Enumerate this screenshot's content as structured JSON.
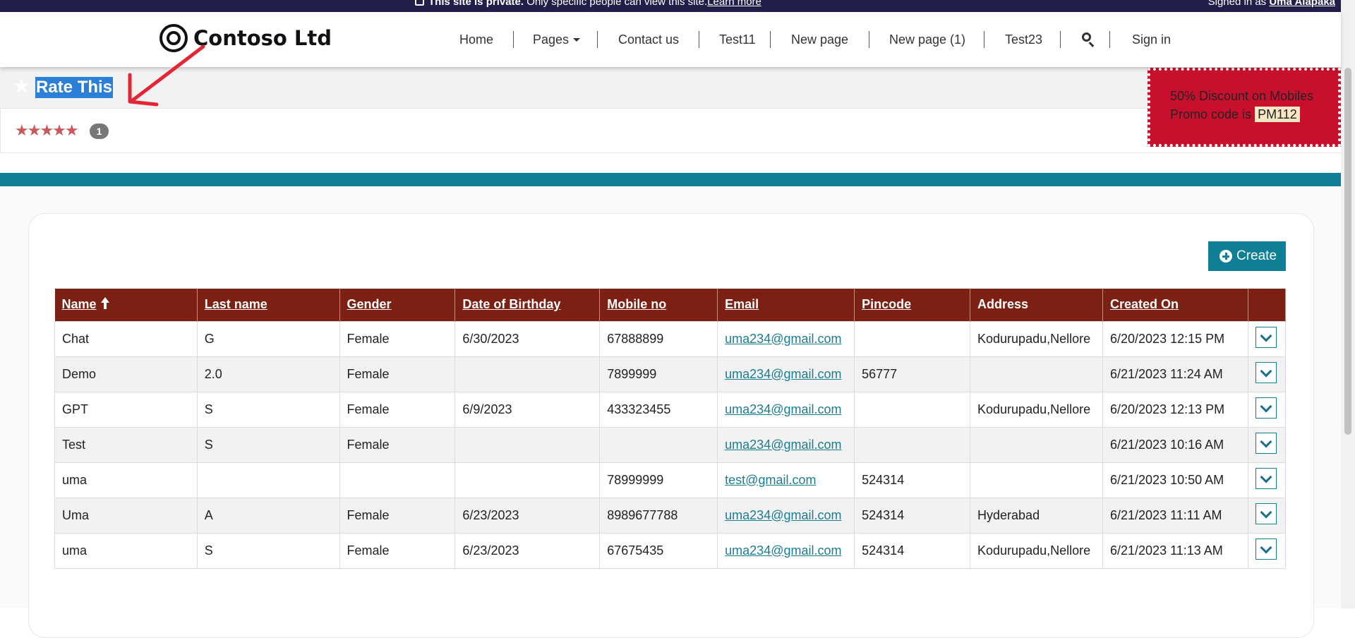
{
  "topbar": {
    "private_bold": "This site is private.",
    "private_text": " Only specific people can view this site.",
    "learn_more": "Learn more",
    "signed_in_prefix": "Signed in as ",
    "user_name": "Uma Alapaka"
  },
  "header": {
    "brand": "Contoso Ltd",
    "nav": [
      "Home",
      "Pages",
      "Contact us",
      "Test11",
      "New page",
      "New page (1)",
      "Test23",
      "Sign in"
    ]
  },
  "rating": {
    "title": "Rate This",
    "stars": "★★★★★",
    "count": "1"
  },
  "promo": {
    "line1": "50% Discount on Mobiles",
    "line2_prefix": "Promo code is ",
    "code": "PM112"
  },
  "create_label": "Create",
  "table": {
    "headers": [
      "Name",
      "Last name",
      "Gender",
      "Date of Birthday",
      "Mobile no",
      "Email",
      "Pincode",
      "Address",
      "Created On"
    ],
    "rows": [
      [
        "Chat",
        "G",
        "Female",
        "6/30/2023",
        "67888899",
        "uma234@gmail.com",
        "",
        "Kodurupadu,Nellore",
        "6/20/2023 12:15 PM"
      ],
      [
        "Demo",
        "2.0",
        "Female",
        "",
        "7899999",
        "uma234@gmail.com",
        "56777",
        "",
        "6/21/2023 11:24 AM"
      ],
      [
        "GPT",
        "S",
        "Female",
        "6/9/2023",
        "433323455",
        "uma234@gmail.com",
        "",
        "Kodurupadu,Nellore",
        "6/20/2023 12:13 PM"
      ],
      [
        "Test",
        "S",
        "Female",
        "",
        "",
        "uma234@gmail.com",
        "",
        "",
        "6/21/2023 10:16 AM"
      ],
      [
        "uma",
        "",
        "",
        "",
        "78999999",
        "test@gmail.com",
        "524314",
        "",
        "6/21/2023 10:50 AM"
      ],
      [
        "Uma",
        "A",
        "Female",
        "6/23/2023",
        "8989677788",
        "uma234@gmail.com",
        "524314",
        "Hyderabad",
        "6/21/2023 11:11 AM"
      ],
      [
        "uma",
        "S",
        "Female",
        "6/23/2023",
        "67675435",
        "uma234@gmail.com",
        "524314",
        "Kodurupadu,Nellore",
        "6/21/2023 11:13 AM"
      ]
    ]
  },
  "colors": {
    "header_bg": "#7c2013",
    "accent": "#0e7f95",
    "promo_bg": "#c8102e",
    "topbar_bg": "#1f1f4a"
  }
}
